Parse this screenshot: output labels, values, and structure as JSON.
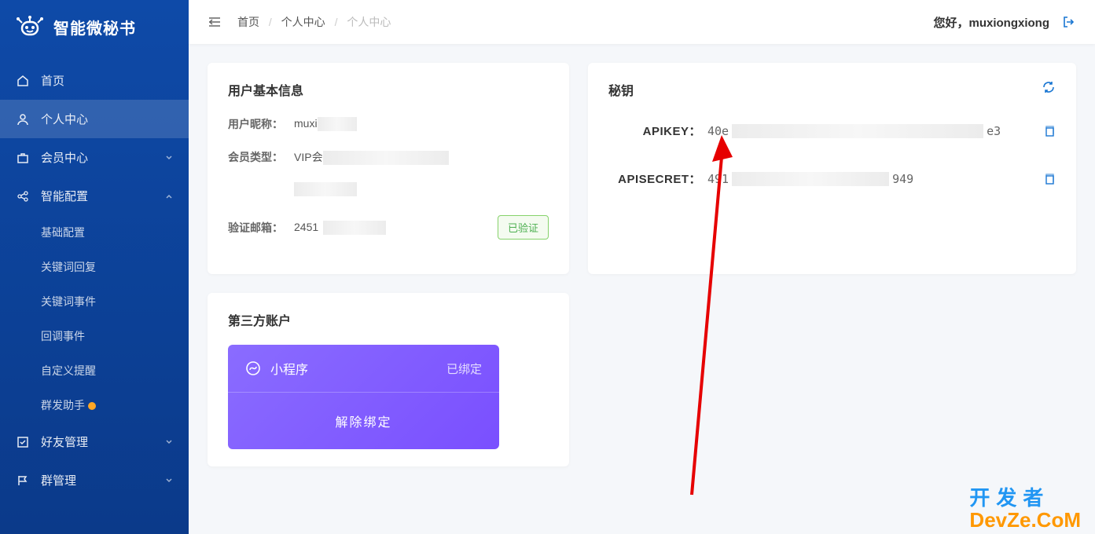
{
  "app": {
    "name": "智能微秘书"
  },
  "header": {
    "greetingPrefix": "您好，",
    "username": "muxiongxiong",
    "breadcrumb": {
      "home": "首页",
      "section": "个人中心",
      "current": "个人中心"
    }
  },
  "sidebar": {
    "items": {
      "home": "首页",
      "profile": "个人中心",
      "member": "会员中心",
      "smart": "智能配置",
      "friends": "好友管理",
      "groups": "群管理"
    },
    "smartChildren": {
      "basic": "基础配置",
      "keywordReply": "关键词回复",
      "keywordEvent": "关键词事件",
      "callback": "回调事件",
      "customRemind": "自定义提醒",
      "massHelper": "群发助手"
    }
  },
  "cards": {
    "userInfo": {
      "title": "用户基本信息",
      "rows": {
        "nickname": {
          "label": "用户昵称：",
          "value": "muxi"
        },
        "memberType": {
          "label": "会员类型：",
          "value": "VIP会"
        },
        "email": {
          "label": "验证邮箱：",
          "value": "2451",
          "verified": "已验证"
        }
      }
    },
    "secret": {
      "title": "秘钥",
      "apikey": {
        "label": "APIKEY：",
        "prefix": "40e",
        "suffix": "e3"
      },
      "apisecret": {
        "label": "APISECRET：",
        "prefix": "491",
        "suffix": "949"
      }
    },
    "third": {
      "title": "第三方账户",
      "miniapp": {
        "name": "小程序",
        "status": "已绑定",
        "action": "解除绑定"
      }
    }
  },
  "watermark": {
    "line1": "开发者",
    "line2": "DevZe.CoM"
  }
}
